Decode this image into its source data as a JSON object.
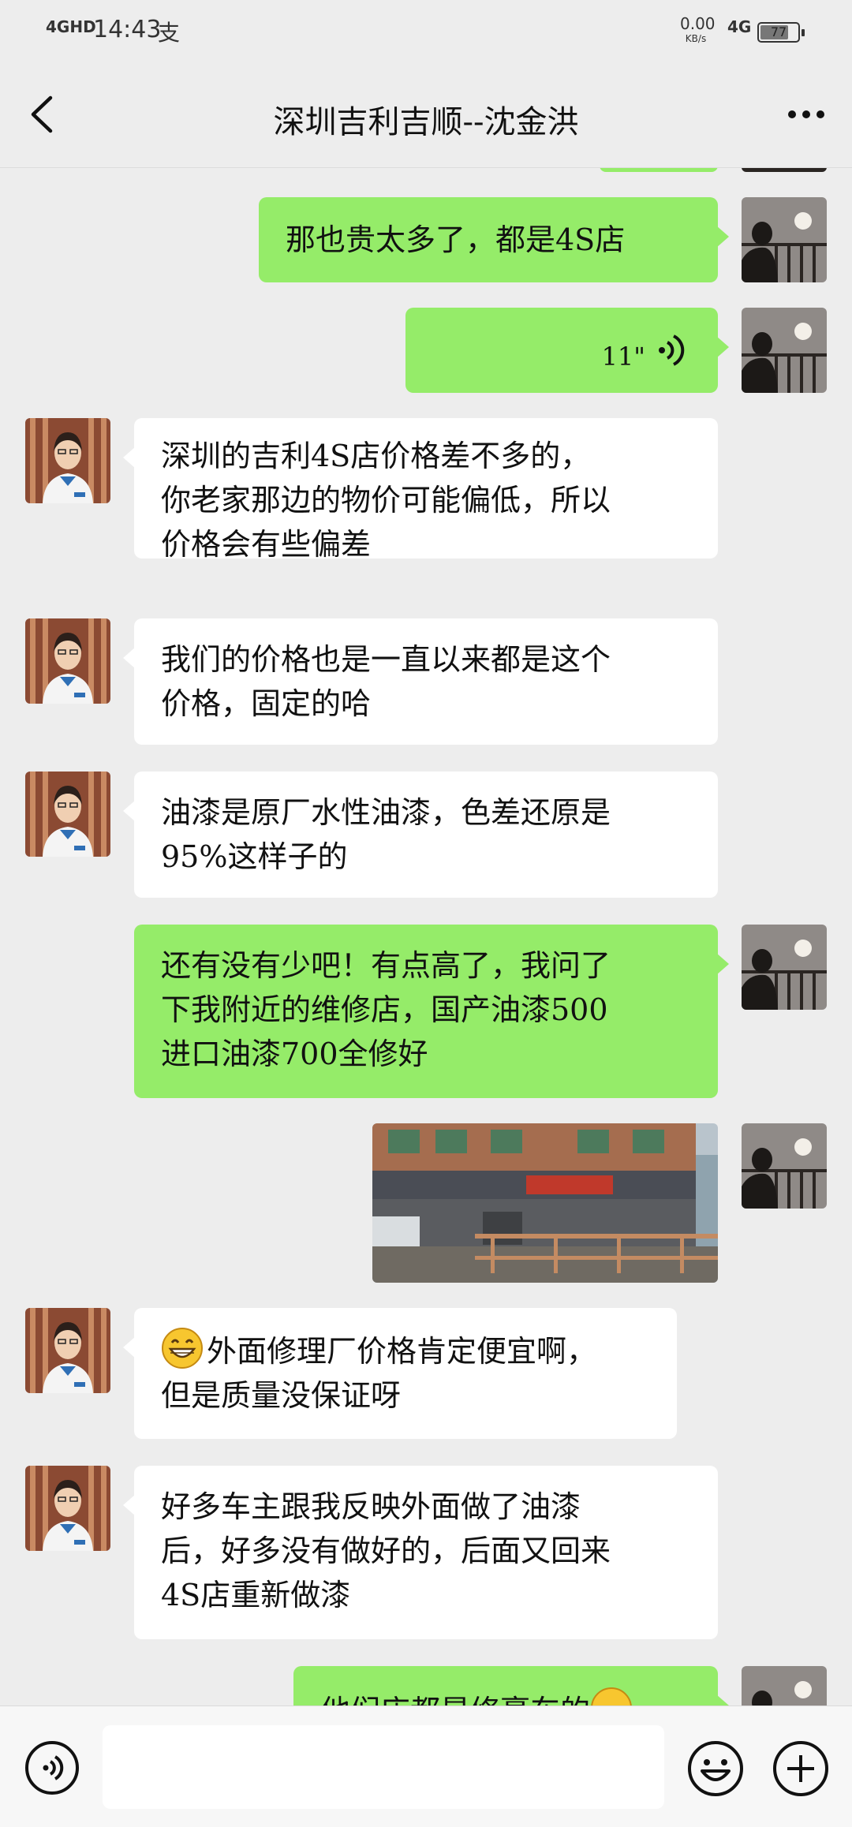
{
  "status_bar": {
    "network": "4GHD",
    "time": "14:43",
    "extra": "支",
    "speed_value": "0.00",
    "speed_unit": "KB/s",
    "signal_type": "4G",
    "battery_level": "77",
    "battery_fraction": 0.77
  },
  "header": {
    "title": "深圳吉利吉顺--沈金洪"
  },
  "messages": [
    {
      "id": 1,
      "from": "me",
      "type": "text",
      "text": "那也贵太多了，都是4S店"
    },
    {
      "id": 2,
      "from": "me",
      "type": "voice",
      "duration": "11\""
    },
    {
      "id": 3,
      "from": "them",
      "type": "text",
      "lines": [
        "深圳的吉利4S店价格差不多的，",
        "你老家那边的物价可能偏低，所以",
        "价格会有些偏差"
      ]
    },
    {
      "id": 4,
      "from": "them",
      "type": "text",
      "lines": [
        "我们的价格也是一直以来都是这个",
        "价格，固定的哈"
      ]
    },
    {
      "id": 5,
      "from": "them",
      "type": "text",
      "lines": [
        "油漆是原厂水性油漆，色差还原是",
        "95%这样子的"
      ]
    },
    {
      "id": 6,
      "from": "me",
      "type": "text",
      "lines": [
        "还有没有少吧！有点高了，我问了",
        "下我附近的维修店，国产油漆500",
        "进口油漆700全修好"
      ]
    },
    {
      "id": 7,
      "from": "me",
      "type": "image"
    },
    {
      "id": 8,
      "from": "them",
      "type": "text",
      "emoji": "grinning-emoji",
      "lines": [
        "外面修理厂价格肯定便宜啊，",
        "但是质量没保证呀"
      ]
    },
    {
      "id": 9,
      "from": "them",
      "type": "text",
      "lines": [
        "好多车主跟我反映外面做了油漆",
        "后，好多没有做好的，后面又回来",
        "4S店重新做漆"
      ]
    },
    {
      "id": 10,
      "from": "me",
      "type": "text",
      "text": "他们店都是修豪车的"
    }
  ],
  "input_bar": {
    "placeholder": "",
    "voice_icon": "voice-mode-icon",
    "emoji_icon": "emoji-icon",
    "plus_icon": "plus-icon"
  },
  "colors": {
    "background": "#ededed",
    "outgoing_bubble": "#95ec69",
    "incoming_bubble": "#ffffff"
  }
}
